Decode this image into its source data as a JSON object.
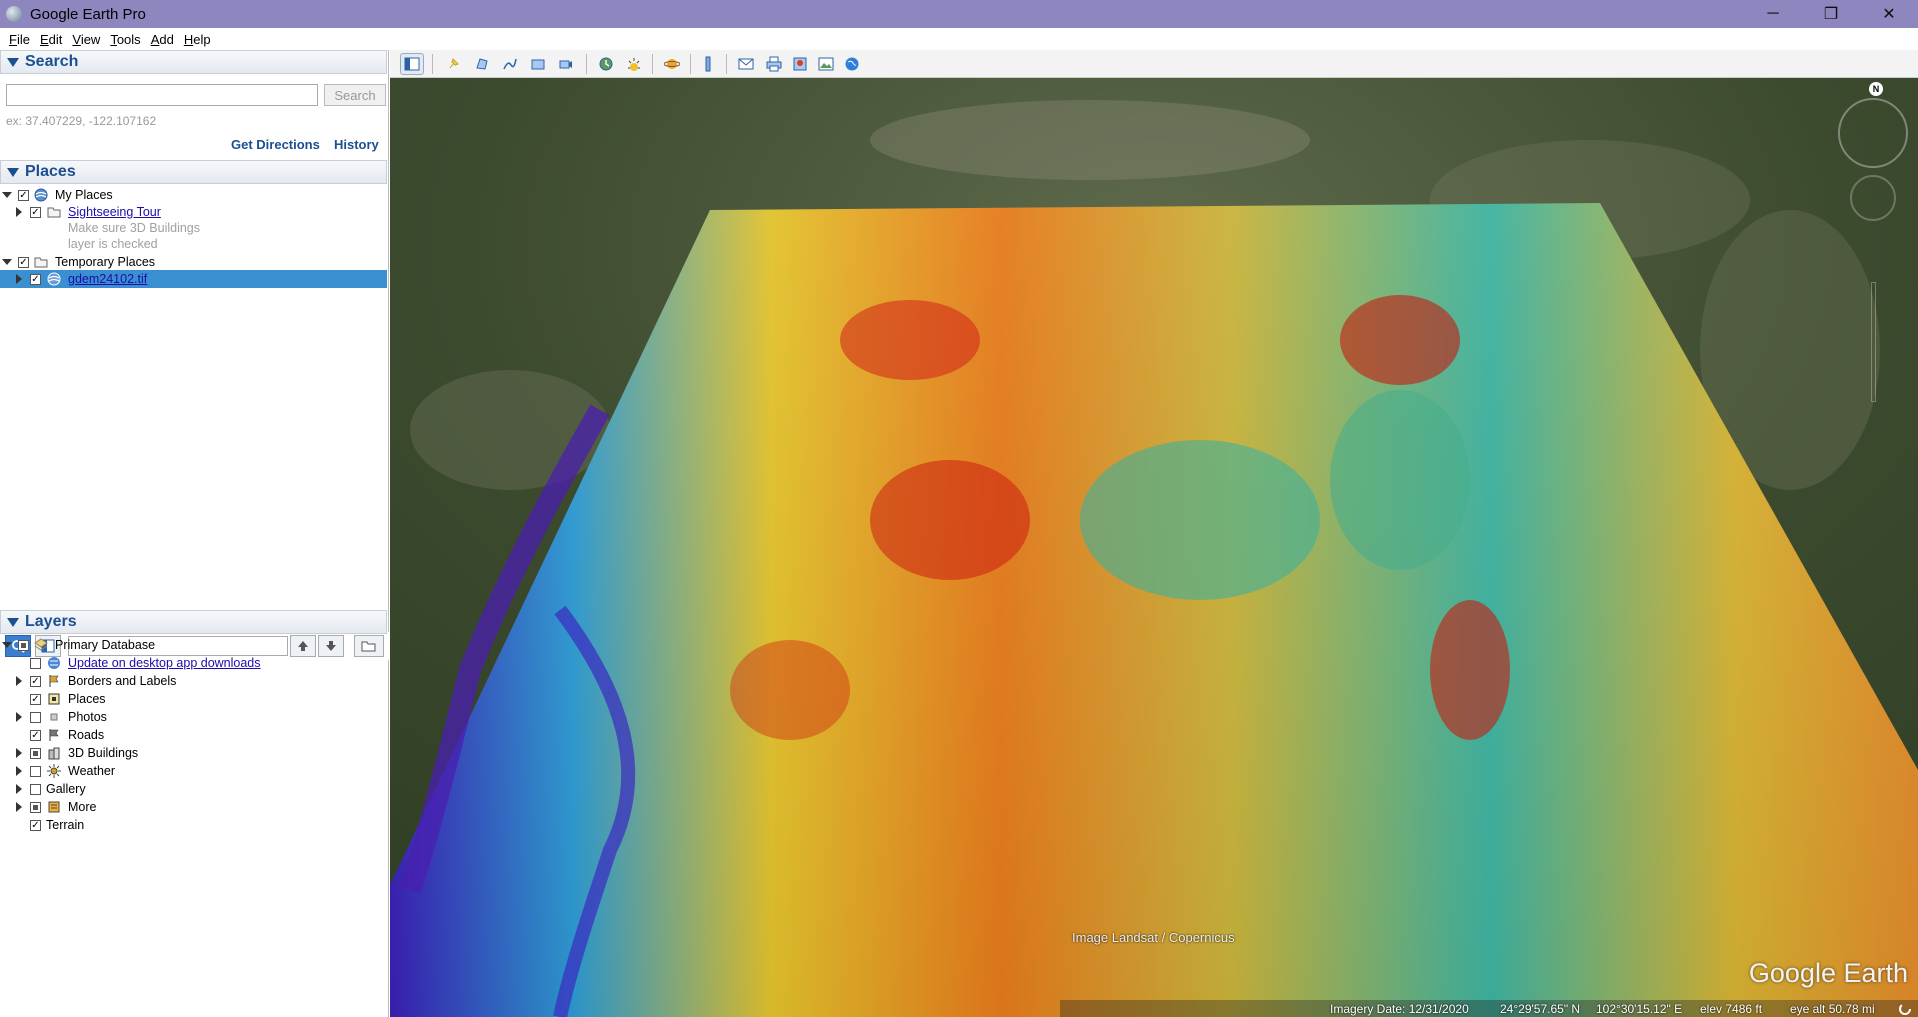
{
  "window": {
    "title": "Google Earth Pro",
    "minimize": "─",
    "maximize": "❐",
    "close": "✕"
  },
  "menu": [
    {
      "pre": "",
      "key": "F",
      "post": "ile"
    },
    {
      "pre": "",
      "key": "E",
      "post": "dit"
    },
    {
      "pre": "",
      "key": "V",
      "post": "iew"
    },
    {
      "pre": "",
      "key": "T",
      "post": "ools"
    },
    {
      "pre": "",
      "key": "A",
      "post": "dd"
    },
    {
      "pre": "",
      "key": "H",
      "post": "elp"
    }
  ],
  "search": {
    "header": "Search",
    "input_value": "",
    "button": "Search",
    "hint": "ex: 37.407229, -122.107162",
    "get_directions": "Get Directions",
    "history": "History"
  },
  "places": {
    "header": "Places",
    "my_places": "My Places",
    "sightseeing": "Sightseeing Tour",
    "sightseeing_note1": "Make sure 3D Buildings",
    "sightseeing_note2": "layer is checked",
    "temporary": "Temporary Places",
    "overlay": "gdem24102.tif"
  },
  "layers": {
    "header": "Layers",
    "items": [
      {
        "label": "Primary Database"
      },
      {
        "label": "Update on desktop app downloads"
      },
      {
        "label": "Borders and Labels"
      },
      {
        "label": "Places"
      },
      {
        "label": "Photos"
      },
      {
        "label": "Roads"
      },
      {
        "label": "3D Buildings"
      },
      {
        "label": "Weather"
      },
      {
        "label": "Gallery"
      },
      {
        "label": "More"
      },
      {
        "label": "Terrain"
      }
    ]
  },
  "map": {
    "attribution": "Image Landsat / Copernicus",
    "brand": "Google Earth",
    "compass_n": "N",
    "imagery_date": "Imagery Date: 12/31/2020",
    "lat": "24°29'57.65\" N",
    "lon": "102°30'15.12\" E",
    "elev": "elev  7486 ft",
    "eye_alt": "eye alt  50.78 mi"
  }
}
